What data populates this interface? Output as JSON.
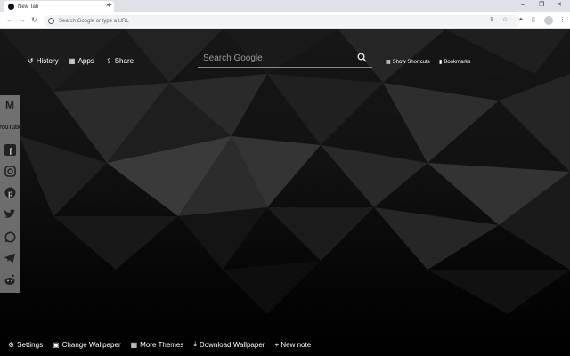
{
  "browser": {
    "tab_title": "New Tab",
    "tab_close": "×",
    "new_tab": "+",
    "omnibox_placeholder": "Search Google or type a URL",
    "win_minimize": "–",
    "win_restore": "❐",
    "win_close": "✕"
  },
  "topnav": {
    "history": "History",
    "apps": "Apps",
    "share": "Share"
  },
  "search": {
    "placeholder": "Search Google"
  },
  "right_links": {
    "show_shortcuts": "Show Shortcuts",
    "bookmarks": "Bookmarks"
  },
  "social": {
    "items": [
      "gmail-icon",
      "youtube-icon",
      "facebook-icon",
      "instagram-icon",
      "pinterest-icon",
      "twitter-icon",
      "whatsapp-icon",
      "telegram-icon",
      "reddit-icon"
    ],
    "youtube_label": "YouTube"
  },
  "bottom": {
    "settings": "Settings",
    "change_wallpaper": "Change Wallpaper",
    "more_themes": "More Themes",
    "download_wallpaper": "Download Wallpaper",
    "new_note": "+ New note"
  },
  "colors": {
    "accent": "#ffffff",
    "background": "#000000"
  }
}
